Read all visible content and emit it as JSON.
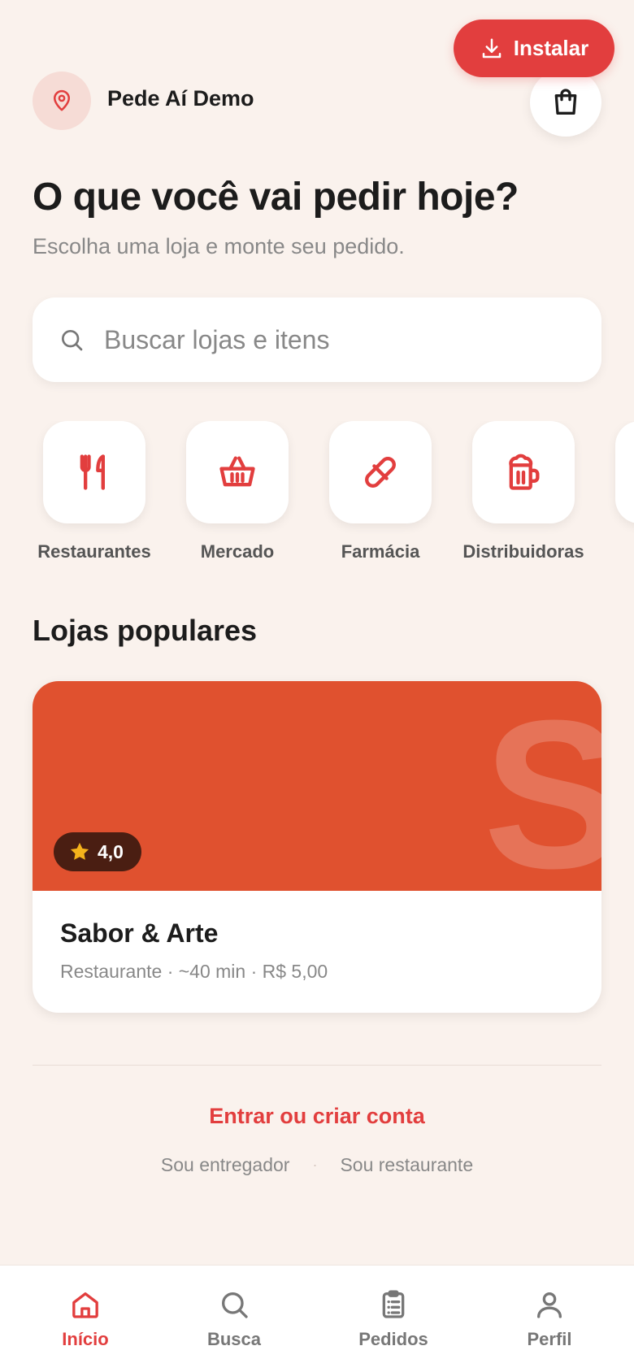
{
  "install_button": {
    "label": "Instalar",
    "icon": "download-icon"
  },
  "header": {
    "brand": "Pede Aí Demo",
    "location_icon": "map-pin-icon",
    "cart_icon": "shopping-bag-icon"
  },
  "hero": {
    "title": "O que você vai pedir hoje?",
    "subtitle": "Escolha uma loja e monte seu pedido."
  },
  "search": {
    "placeholder": "Buscar lojas e itens",
    "value": "",
    "icon": "search-icon"
  },
  "categories": [
    {
      "label": "Restaurantes",
      "icon": "utensils-icon"
    },
    {
      "label": "Mercado",
      "icon": "basket-icon"
    },
    {
      "label": "Farmácia",
      "icon": "pill-icon"
    },
    {
      "label": "Distribuidoras",
      "icon": "beer-mug-icon"
    }
  ],
  "popular": {
    "title": "Lojas populares",
    "stores": [
      {
        "initial": "S",
        "rating": "4,0",
        "name": "Sabor & Arte",
        "meta": "Restaurante · ~40 min · R$ 5,00",
        "banner_color": "#e0512f"
      }
    ]
  },
  "footer": {
    "login_label": "Entrar ou criar conta",
    "courier_label": "Sou entregador",
    "separator": "·",
    "restaurant_label": "Sou restaurante"
  },
  "bottom_nav": [
    {
      "label": "Início",
      "icon": "home-icon",
      "active": true
    },
    {
      "label": "Busca",
      "icon": "search-icon",
      "active": false
    },
    {
      "label": "Pedidos",
      "icon": "clipboard-list-icon",
      "active": false
    },
    {
      "label": "Perfil",
      "icon": "user-icon",
      "active": false
    }
  ],
  "colors": {
    "accent": "#e23e3e",
    "background": "#faf2ed",
    "rating_badge": "#4a1e12",
    "star": "#f5b21b"
  }
}
